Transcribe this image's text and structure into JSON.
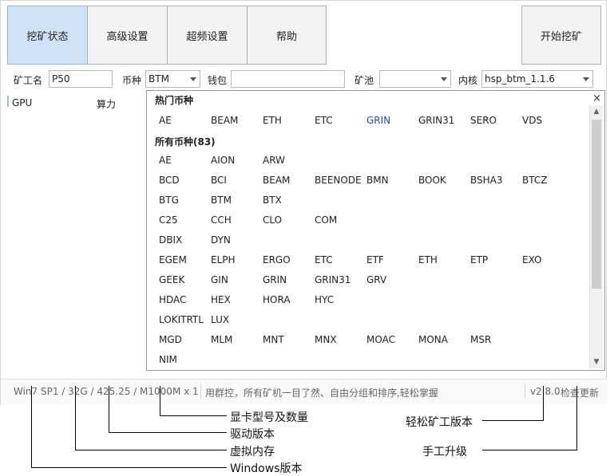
{
  "toolbar": {
    "tabs": [
      {
        "label": "挖矿状态",
        "active": true
      },
      {
        "label": "高级设置",
        "active": false
      },
      {
        "label": "超频设置",
        "active": false
      },
      {
        "label": "帮助",
        "active": false
      }
    ],
    "start_button": "开始挖矿"
  },
  "form": {
    "worker_label": "矿工名",
    "worker_value": "P50",
    "coin_label": "币种",
    "coin_value": "BTM",
    "wallet_label": "钱包",
    "wallet_value": "",
    "pool_label": "矿池",
    "pool_value": "",
    "kernel_label": "内核",
    "kernel_value": "hsp_btm_1.1.6"
  },
  "list": {
    "col_gpu": "GPU",
    "col_hashrate": "算力"
  },
  "dropdown": {
    "hot_title": "热门币种",
    "hot": [
      "AE",
      "BEAM",
      "ETH",
      "ETC",
      "GRIN",
      "GRIN31",
      "SERO",
      "VDS"
    ],
    "highlighted": "GRIN",
    "all_title": "所有币种(83)",
    "all_rows": [
      [
        "AE",
        "AION",
        "ARW"
      ],
      [
        "BCD",
        "BCI",
        "BEAM",
        "BEENODE",
        "BMN",
        "BOOK",
        "BSHA3",
        "BTCZ"
      ],
      [
        "BTG",
        "BTM",
        "BTX"
      ],
      [
        "C25",
        "CCH",
        "CLO",
        "COM"
      ],
      [
        "DBIX",
        "DYN"
      ],
      [
        "EGEM",
        "ELPH",
        "ERGO",
        "ETC",
        "ETF",
        "ETH",
        "ETP",
        "EXO"
      ],
      [
        "GEEK",
        "GIN",
        "GRIN",
        "GRIN31",
        "GRV"
      ],
      [
        "HDAC",
        "HEX",
        "HORA",
        "HYC"
      ],
      [
        "LOKITRTL",
        "LUX"
      ],
      [
        "MGD",
        "MLM",
        "MNT",
        "MNX",
        "MOAC",
        "MONA",
        "MSR"
      ],
      [
        "NIM"
      ]
    ],
    "close_glyph": "×",
    "scroll_position": 0.0
  },
  "status": {
    "system_info": "Win7 SP1 / 32G / 425.25 / M1000M x 1",
    "promo": "用群控，所有矿机一目了然、自由分组和排序,轻松掌握",
    "version": "v2.8.0",
    "check_update": "检查更新"
  },
  "annotations": {
    "gpu_model": "显卡型号及数量",
    "driver": "驱动版本",
    "virtual_memory": "虚拟内存",
    "windows_version": "Windows版本",
    "miner_version": "轻松矿工版本",
    "manual_upgrade": "手工升级"
  },
  "colors": {
    "active_tab": "#cfe3f7",
    "highlight": "#2146c7"
  }
}
